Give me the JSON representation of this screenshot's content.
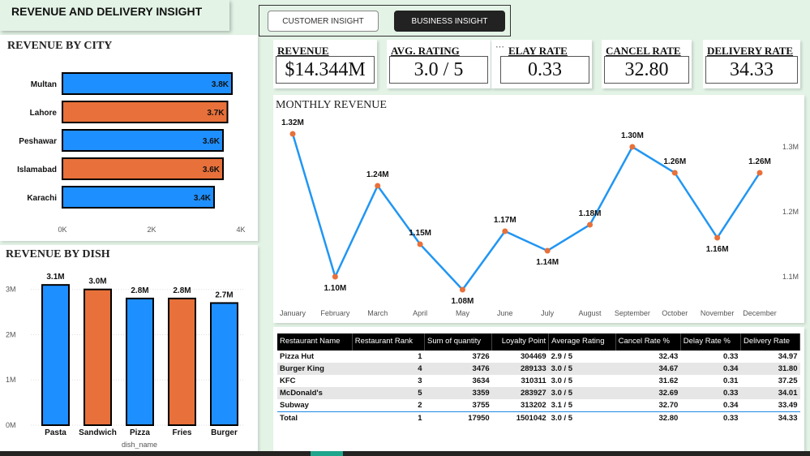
{
  "header": {
    "title": "REVENUE AND DELIVERY INSIGHT"
  },
  "nav": {
    "customer_label": "CUSTOMER INSIGHT",
    "business_label": "BUSINESS INSIGHT"
  },
  "colors": {
    "blue": "#1e8fff",
    "orange": "#e8703a",
    "line": "#2196f3",
    "point": "#e8703a"
  },
  "kpis": [
    {
      "label": "REVENUE",
      "value": "$14.344M"
    },
    {
      "label": "AVG. RATING",
      "value": "3.0 / 5"
    },
    {
      "label": "ELAY RATE",
      "value": "0.33"
    },
    {
      "label": "CANCEL RATE",
      "value": "32.80"
    },
    {
      "label": "DELIVERY RATE",
      "value": "34.33"
    }
  ],
  "more_icon": "ellipsis-icon",
  "city_chart": {
    "title": "REVENUE BY CITY",
    "chart_data": {
      "type": "bar",
      "orientation": "horizontal",
      "categories": [
        "Multan",
        "Lahore",
        "Peshawar",
        "Islamabad",
        "Karachi"
      ],
      "values": [
        3.8,
        3.7,
        3.6,
        3.6,
        3.4
      ],
      "labels": [
        "3.8K",
        "3.7K",
        "3.6K",
        "3.6K",
        "3.4K"
      ],
      "colors": [
        "blue",
        "orange",
        "blue",
        "orange",
        "blue"
      ],
      "xlim": [
        0,
        4
      ],
      "xticks": [
        "0K",
        "2K",
        "4K"
      ]
    }
  },
  "dish_chart": {
    "title": "REVENUE BY DISH",
    "chart_data": {
      "type": "bar",
      "categories": [
        "Pasta",
        "Sandwich",
        "Pizza",
        "Fries",
        "Burger"
      ],
      "values": [
        3.1,
        3.0,
        2.8,
        2.8,
        2.7
      ],
      "labels": [
        "3.1M",
        "3.0M",
        "2.8M",
        "2.8M",
        "2.7M"
      ],
      "colors": [
        "blue",
        "orange",
        "blue",
        "orange",
        "blue"
      ],
      "ylim": [
        0,
        3.3
      ],
      "yticks": [
        "0M",
        "1M",
        "2M",
        "3M"
      ],
      "xlabel": "dish_name"
    }
  },
  "monthly_chart": {
    "title": "MONTHLY REVENUE",
    "chart_data": {
      "type": "line",
      "categories": [
        "January",
        "February",
        "March",
        "April",
        "May",
        "June",
        "July",
        "August",
        "September",
        "October",
        "November",
        "December"
      ],
      "values": [
        1.32,
        1.1,
        1.24,
        1.15,
        1.08,
        1.17,
        1.14,
        1.18,
        1.3,
        1.26,
        1.16,
        1.26
      ],
      "labels": [
        "1.32M",
        "1.10M",
        "1.24M",
        "1.15M",
        "1.08M",
        "1.17M",
        "1.14M",
        "1.18M",
        "1.30M",
        "1.26M",
        "1.16M",
        "1.26M"
      ],
      "yticks": [
        "1.1M",
        "1.2M",
        "1.3M"
      ],
      "ylim": [
        1.07,
        1.33
      ]
    }
  },
  "table": {
    "columns": [
      "Restaurant Name",
      "Restaurant Rank",
      "Sum of quantity",
      "Loyalty Point",
      "Average Rating",
      "Cancel Rate %",
      "Delay Rate %",
      "Delivery Rate"
    ],
    "rows": [
      [
        "Pizza Hut",
        "1",
        "3726",
        "304469",
        "2.9 / 5",
        "32.43",
        "0.33",
        "34.97"
      ],
      [
        "Burger King",
        "4",
        "3476",
        "289133",
        "3.0 / 5",
        "34.67",
        "0.34",
        "31.80"
      ],
      [
        "KFC",
        "3",
        "3634",
        "310311",
        "3.0 / 5",
        "31.62",
        "0.31",
        "37.25"
      ],
      [
        "McDonald's",
        "5",
        "3359",
        "283927",
        "3.0 / 5",
        "32.69",
        "0.33",
        "34.01"
      ],
      [
        "Subway",
        "2",
        "3755",
        "313202",
        "3.1 / 5",
        "32.70",
        "0.34",
        "33.49"
      ]
    ],
    "total": [
      "Total",
      "1",
      "17950",
      "1501042",
      "3.0 / 5",
      "32.80",
      "0.33",
      "34.33"
    ]
  }
}
